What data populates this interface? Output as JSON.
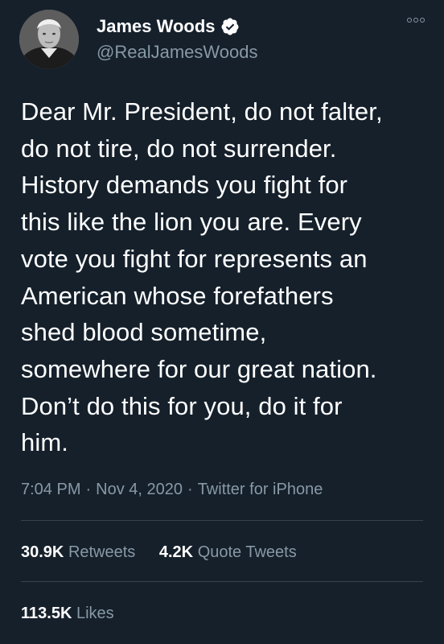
{
  "user": {
    "display_name": "James Woods",
    "handle": "@RealJamesWoods",
    "verified": true
  },
  "tweet": {
    "text": "Dear Mr. President, do not falter,\ndo not tire, do not surrender.\nHistory demands you fight for\nthis like the lion you are. Every\nvote you fight for represents an\nAmerican whose forefathers\nshed blood sometime,\nsomewhere for our great nation.\nDon’t do this for you, do it for\nhim.",
    "time": "7:04 PM",
    "date": "Nov 4, 2020",
    "separator": "·",
    "source": "Twitter for iPhone"
  },
  "stats": {
    "retweets_count": "30.9K",
    "retweets_label": "Retweets",
    "quote_tweets_count": "4.2K",
    "quote_tweets_label": "Quote Tweets",
    "likes_count": "113.5K",
    "likes_label": "Likes"
  },
  "icons": {
    "verified": "verified-badge-icon",
    "more": "more-options-icon"
  },
  "colors": {
    "background": "#15202b",
    "primary_text": "#ffffff",
    "secondary_text": "#8899a6",
    "divider": "#38444d"
  }
}
